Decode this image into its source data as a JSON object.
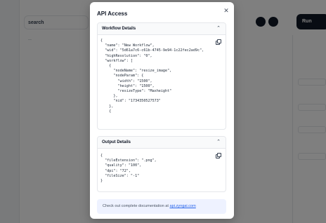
{
  "modal": {
    "title": "API Access",
    "workflow_section": {
      "title": "Workflow Details",
      "code": "{\n  \"name\": \"New Workflow\",\n  \"wid\": \"5d61a7c6-c61b-4745-9e94-1c22fec2ad9c\",\n  \"highResolution\": \"0\",\n  \"workflow\": [\n    {\n      \"nodeName\": \"resize_image\",\n      \"nodeParam\": {\n        \"width\": \"1500\",\n        \"height\": \"1500\",\n        \"resizeType\": \"Maxheight\"\n      },\n      \"nid\": \"1734350527573\"\n    },\n    {"
    },
    "output_section": {
      "title": "Output Details",
      "code": "{\n  \"fileExtension\": \".png\",\n  \"quality\": \"100\",\n  \"dpi\": \"72\",\n  \"fileSize\": \"-1\"\n}"
    },
    "documentation": {
      "prefix": "Check out complete documentation at ",
      "link_text": "api.zyngai.com"
    }
  },
  "icons": {
    "close": "close-icon",
    "collapse": "chevron-up-icon",
    "copy": "copy-icon"
  },
  "background": {
    "search_text": "search",
    "run_label": "Run"
  },
  "colors": {
    "overlay": "rgba(0,0,0,0.5)",
    "link": "#2563eb",
    "doc_box": "#eef2ff"
  }
}
